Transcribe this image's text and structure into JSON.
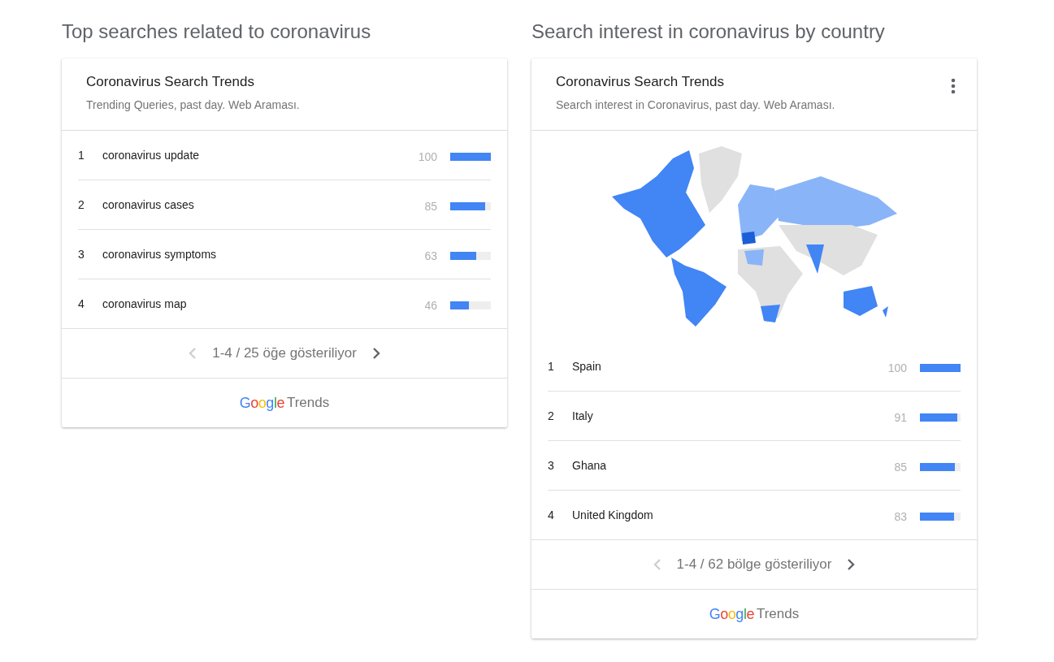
{
  "panels": [
    {
      "heading": "Top searches related to coronavirus",
      "card": {
        "title": "Coronavirus Search Trends",
        "subtitle": "Trending Queries, past day. Web Araması.",
        "has_menu": false,
        "map": false,
        "rows": [
          {
            "rank": "1",
            "label": "coronavirus update",
            "value": "100",
            "level": 1.0
          },
          {
            "rank": "2",
            "label": "coronavirus cases",
            "value": "85",
            "level": 0.85
          },
          {
            "rank": "3",
            "label": "coronavirus symptoms",
            "value": "63",
            "level": 0.63
          },
          {
            "rank": "4",
            "label": "coronavirus map",
            "value": "46",
            "level": 0.46
          }
        ],
        "pager": {
          "text": "1-4 / 25 öğe gösteriliyor",
          "prev_disabled": true,
          "next_disabled": false
        },
        "footer": {
          "logo": "Google",
          "product": "Trends"
        }
      }
    },
    {
      "heading": "Search interest in coronavirus by country",
      "card": {
        "title": "Coronavirus Search Trends",
        "subtitle": "Search interest in Coronavirus, past day. Web Araması.",
        "has_menu": true,
        "map": true,
        "rows": [
          {
            "rank": "1",
            "label": "Spain",
            "value": "100",
            "level": 1.0
          },
          {
            "rank": "2",
            "label": "Italy",
            "value": "91",
            "level": 0.91
          },
          {
            "rank": "3",
            "label": "Ghana",
            "value": "85",
            "level": 0.85
          },
          {
            "rank": "4",
            "label": "United Kingdom",
            "value": "83",
            "level": 0.83
          }
        ],
        "pager": {
          "text": "1-4 / 62 bölge gösteriliyor",
          "prev_disabled": true,
          "next_disabled": false
        },
        "footer": {
          "logo": "Google",
          "product": "Trends"
        }
      }
    }
  ]
}
